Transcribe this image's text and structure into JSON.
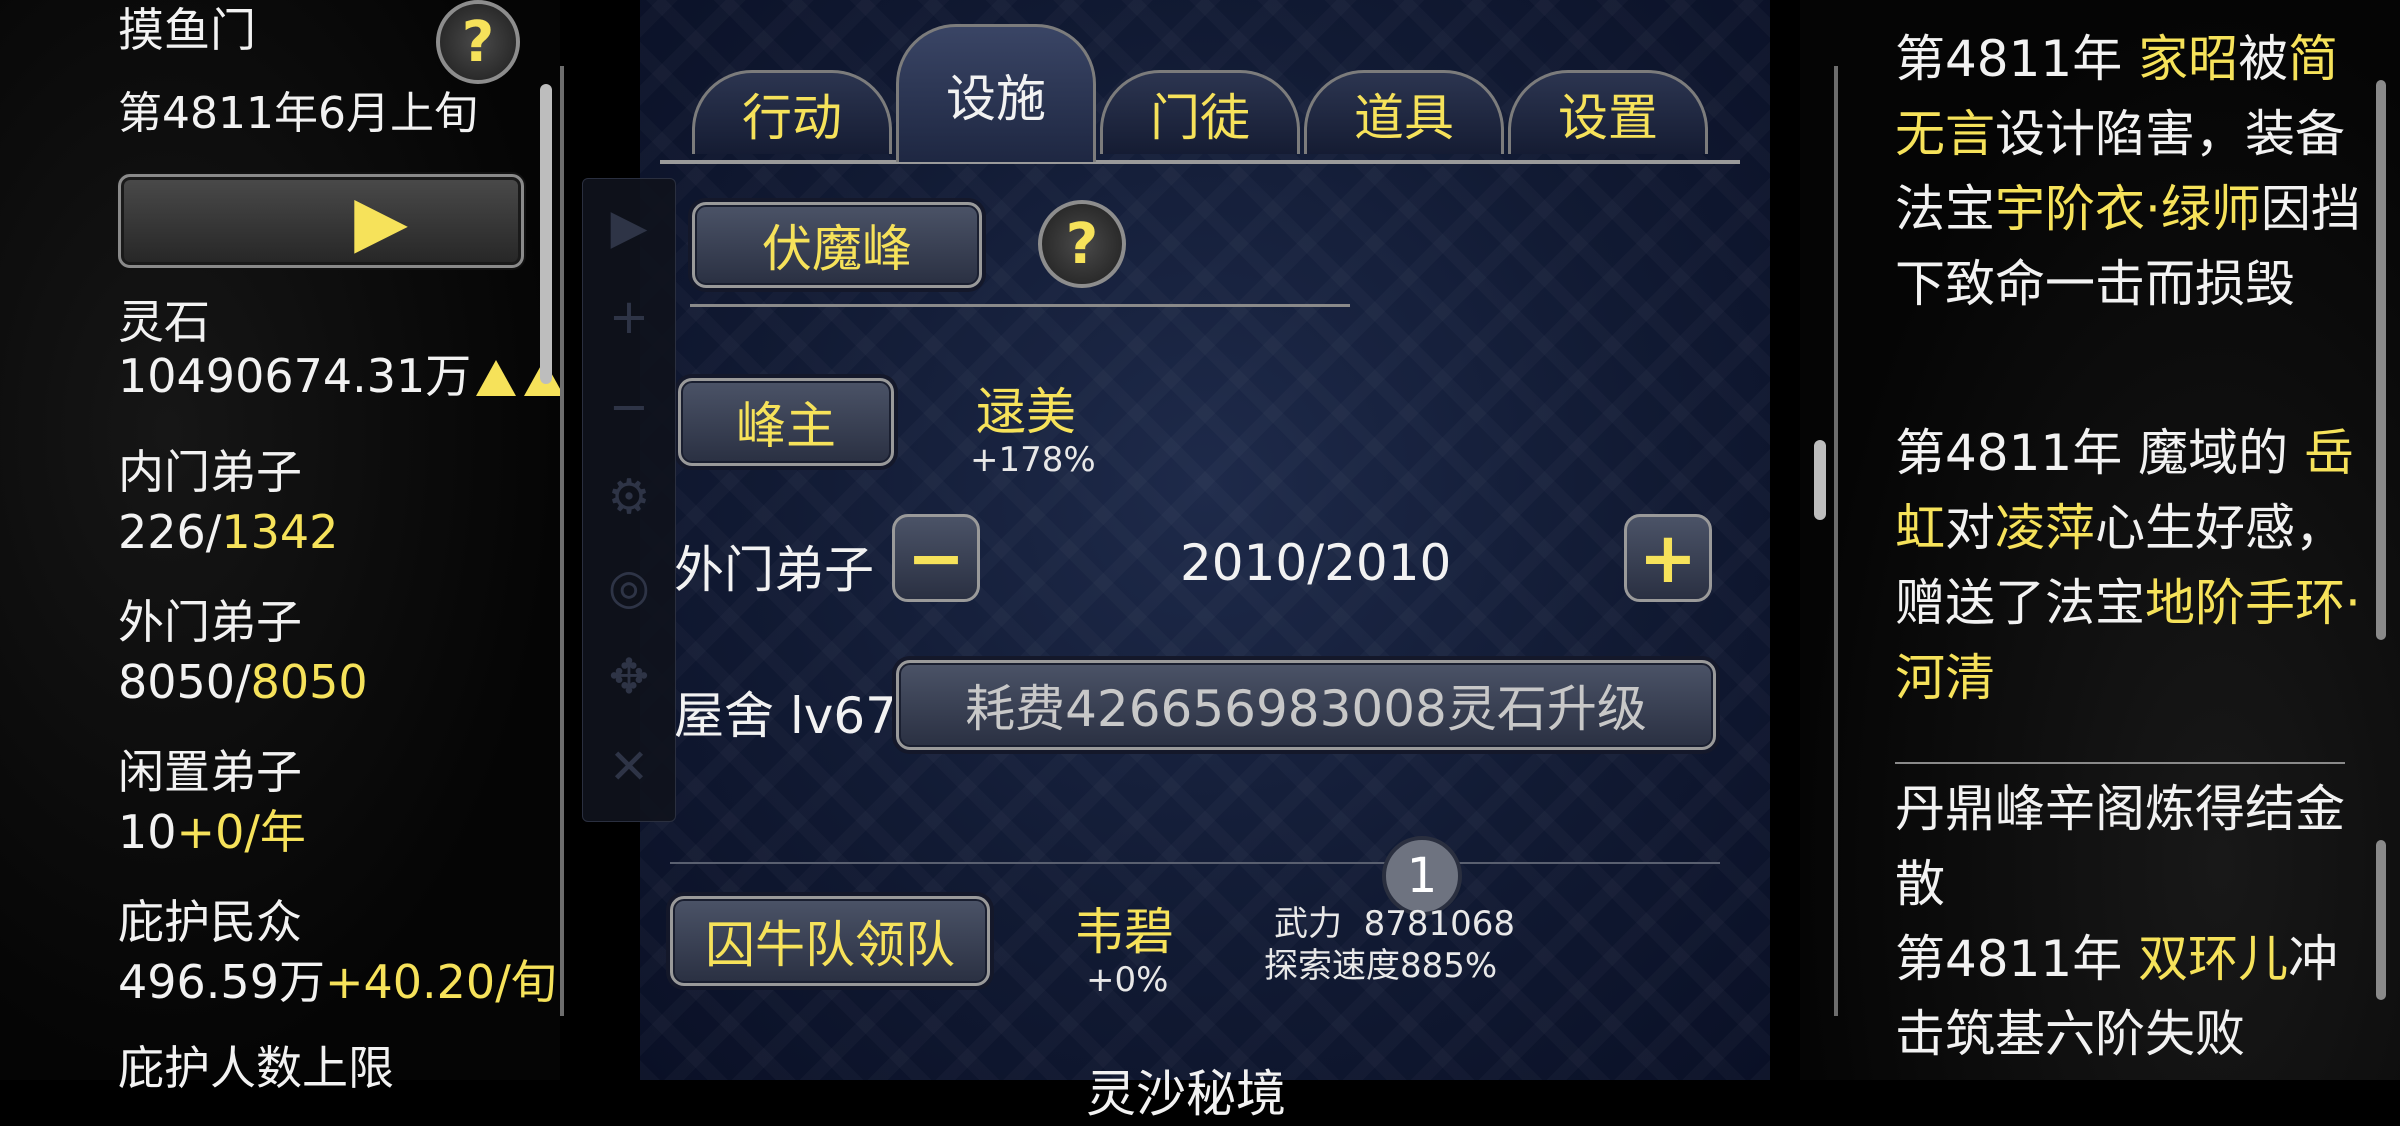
{
  "sect": {
    "name": "摸鱼门",
    "date": "第4811年6月上旬"
  },
  "left_stats": {
    "spirit_stone_label": "灵石",
    "spirit_stone_value": "10490674.31万",
    "inner_label": "内门弟子",
    "inner_current": "226/",
    "inner_max": "1342",
    "outer_label": "外门弟子",
    "outer_current": "8050/",
    "outer_max": "8050",
    "idle_label": "闲置弟子",
    "idle_value": "10",
    "idle_rate": "+0/年",
    "protect_label": "庇护民众",
    "protect_value": "496.59万",
    "protect_rate": "+40.20/旬",
    "protect_limit_label": "庇护人数上限"
  },
  "tabs": [
    {
      "label": "行动",
      "active": false
    },
    {
      "label": "设施",
      "active": true
    },
    {
      "label": "门徒",
      "active": false
    },
    {
      "label": "道具",
      "active": false
    },
    {
      "label": "设置",
      "active": false
    }
  ],
  "facility": {
    "name": "伏魔峰",
    "master_button": "峰主",
    "master_name": "逯美",
    "master_bonus": "+178%",
    "outer_label": "外门弟子",
    "outer_value": "2010/2010",
    "house_label": "屋舍 lv67",
    "upgrade_button": "耗费426656983008灵石升级",
    "center_badge": "1",
    "team_button": "囚牛队领队",
    "team_leader": "韦碧",
    "team_bonus": "+0%",
    "force_label": "武力",
    "force_value": "8781068",
    "explore_label": "探索速度885%",
    "next_item": "灵沙秘境"
  },
  "log": {
    "entry1": {
      "p1": "第4811年 ",
      "n1": "家昭",
      "p2": "被",
      "n2": "简无言",
      "p3": "设计陷害，装备法宝",
      "n3": "宇阶衣·绿师",
      "p4": "因挡下致命一击而损毁"
    },
    "entry2": {
      "p1": "第4811年 魔域的 ",
      "n1": "岳虹",
      "p2": "对",
      "n2": "凌萍",
      "p3": "心生好感，赠送了法宝",
      "n3": "地阶手环·河清"
    },
    "entry3": {
      "text": "丹鼎峰辛阁炼得结金散"
    },
    "entry4": {
      "p1": "第4811年 ",
      "n1": "双环儿",
      "p2": "冲击筑基六阶失败"
    }
  },
  "icons": {
    "help": "?",
    "play": "▶",
    "plus": "+",
    "minus": "−",
    "settings": "⚙",
    "hide": "◎",
    "move": "✥",
    "close": "✕"
  }
}
